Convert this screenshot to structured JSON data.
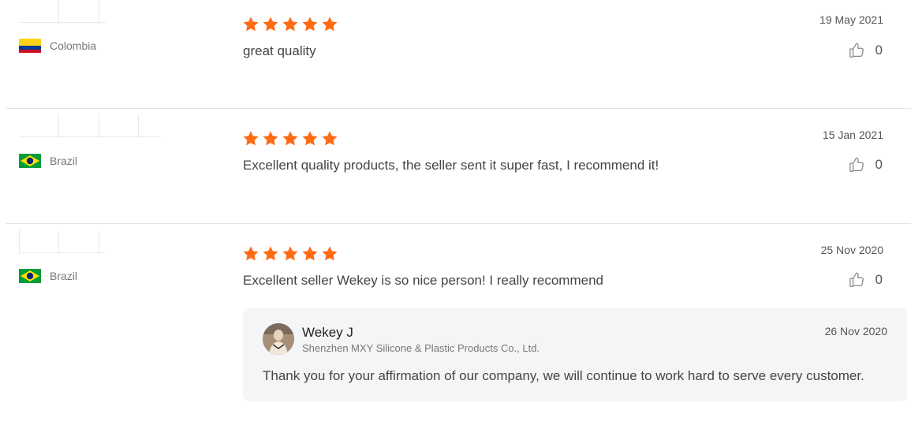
{
  "colors": {
    "star": "#ff6a13",
    "text": "#444444",
    "muted": "#777777",
    "reply_bg": "#f4f5f7"
  },
  "reviews": [
    {
      "country": "Colombia",
      "flag": "colombia",
      "rating": 5,
      "comment": "great quality",
      "date": "19 May 2021",
      "likes": "0"
    },
    {
      "country": "Brazil",
      "flag": "brazil",
      "rating": 5,
      "comment": "Excellent quality products, the seller sent it super fast, I recommend it!",
      "date": "15 Jan 2021",
      "likes": "0"
    },
    {
      "country": "Brazil",
      "flag": "brazil",
      "rating": 5,
      "comment": "Excellent seller Wekey is so nice person! I really recommend",
      "date": "25 Nov 2020",
      "likes": "0",
      "reply": {
        "name": "Wekey J",
        "company": "Shenzhen MXY Silicone & Plastic Products Co., Ltd.",
        "date": "26 Nov 2020",
        "text": "Thank you for your affirmation of our company, we will continue to work hard to serve every customer."
      }
    }
  ]
}
